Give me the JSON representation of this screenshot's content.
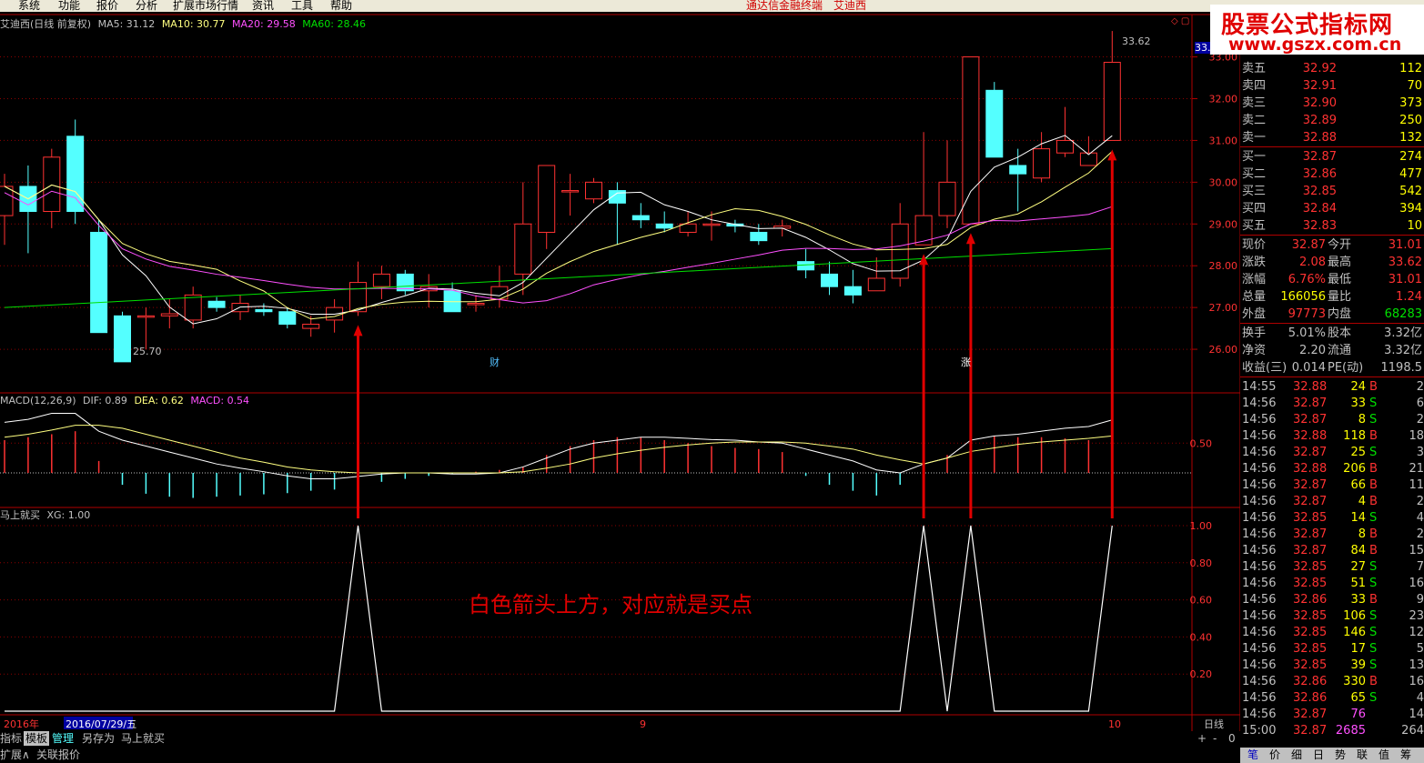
{
  "menu": {
    "items": [
      "系统",
      "功能",
      "报价",
      "分析",
      "扩展市场行情",
      "资讯",
      "工具",
      "帮助"
    ],
    "center_title": "通达信金融终端",
    "stock_name": "艾迪西"
  },
  "brand": {
    "line1": "股票公式指标网",
    "line2": "www.gszx.com.cn"
  },
  "main_header": {
    "title": "艾迪西(日线 前复权)",
    "ma5": "MA5: 31.12",
    "ma10": "MA10: 30.77",
    "ma20": "MA20: 29.58",
    "ma60": "MA60: 28.46"
  },
  "macd_header": {
    "title": "MACD(12,26,9)",
    "dif": "DIF: 0.89",
    "dea": "DEA: 0.62",
    "macd": "MACD: 0.54"
  },
  "xg_header": {
    "title": "马上就买",
    "xg": "XG: 1.00"
  },
  "annotation": "白色箭头上方，对应就是买点",
  "markers": {
    "cai": "财",
    "zhang": "涨"
  },
  "labels": {
    "high": "33.62",
    "low": "25.70",
    "current_price_tag": "33.0",
    "window_icons": "◇ ▢"
  },
  "price_axis": [
    "33.00",
    "32.00",
    "31.00",
    "30.00",
    "29.00",
    "28.00",
    "27.00",
    "26.00"
  ],
  "macd_axis": [
    "0.50"
  ],
  "xg_axis": [
    "1.00",
    "0.80",
    "0.60",
    "0.40",
    "0.20"
  ],
  "time_axis": {
    "year": "2016年",
    "cursor_date": "2016/07/29/五",
    "tick_9": "9",
    "tick_10": "10",
    "period": "日线"
  },
  "bottom_tabs": [
    "指标",
    "模板",
    "管理",
    "另存为",
    "马上就买"
  ],
  "bottom_tabs2": [
    "扩展∧",
    "关联报价"
  ],
  "bottom_right": [
    "+",
    "-",
    "0"
  ],
  "side_tabs": [
    "笔",
    "价",
    "细",
    "日",
    "势",
    "联",
    "值",
    "筹"
  ],
  "colors": {
    "up": "#ff3232",
    "down": "#54ffff",
    "ma5": "#ffffff",
    "ma10": "#ffff80",
    "ma20": "#ff50ff",
    "ma60": "#00e000",
    "grid": "#8b0000",
    "arrow": "#e00000"
  },
  "chart_data": {
    "type": "candlestick",
    "candles": [
      {
        "o": 29.2,
        "h": 30.2,
        "l": 28.5,
        "c": 29.9
      },
      {
        "o": 29.9,
        "h": 30.4,
        "l": 28.3,
        "c": 29.3
      },
      {
        "o": 29.3,
        "h": 30.8,
        "l": 28.9,
        "c": 30.6
      },
      {
        "o": 31.1,
        "h": 31.5,
        "l": 29.0,
        "c": 29.3
      },
      {
        "o": 28.8,
        "h": 29.1,
        "l": 26.4,
        "c": 26.4
      },
      {
        "o": 26.8,
        "h": 26.9,
        "l": 25.7,
        "c": 25.7
      },
      {
        "o": 26.8,
        "h": 27.0,
        "l": 26.0,
        "c": 26.8
      },
      {
        "o": 26.8,
        "h": 27.2,
        "l": 26.5,
        "c": 26.85
      },
      {
        "o": 26.7,
        "h": 27.5,
        "l": 26.5,
        "c": 27.3
      },
      {
        "o": 27.15,
        "h": 27.25,
        "l": 26.9,
        "c": 27.0
      },
      {
        "o": 26.9,
        "h": 27.3,
        "l": 26.7,
        "c": 27.1
      },
      {
        "o": 26.95,
        "h": 27.1,
        "l": 26.8,
        "c": 26.9
      },
      {
        "o": 26.9,
        "h": 27.0,
        "l": 26.5,
        "c": 26.6
      },
      {
        "o": 26.5,
        "h": 26.8,
        "l": 26.3,
        "c": 26.6
      },
      {
        "o": 26.7,
        "h": 27.2,
        "l": 26.4,
        "c": 27.0
      },
      {
        "o": 26.9,
        "h": 28.1,
        "l": 26.8,
        "c": 27.6
      },
      {
        "o": 27.5,
        "h": 28.0,
        "l": 27.2,
        "c": 27.8
      },
      {
        "o": 27.8,
        "h": 27.9,
        "l": 27.3,
        "c": 27.4
      },
      {
        "o": 27.4,
        "h": 27.8,
        "l": 27.0,
        "c": 27.5
      },
      {
        "o": 27.4,
        "h": 27.6,
        "l": 26.9,
        "c": 26.9
      },
      {
        "o": 27.1,
        "h": 27.3,
        "l": 26.9,
        "c": 27.1
      },
      {
        "o": 27.2,
        "h": 28.0,
        "l": 27.0,
        "c": 27.5
      },
      {
        "o": 27.8,
        "h": 30.0,
        "l": 27.3,
        "c": 29.0
      },
      {
        "o": 28.8,
        "h": 30.4,
        "l": 28.4,
        "c": 30.4
      },
      {
        "o": 29.8,
        "h": 30.2,
        "l": 29.2,
        "c": 29.8
      },
      {
        "o": 29.6,
        "h": 30.1,
        "l": 29.5,
        "c": 30.0
      },
      {
        "o": 29.8,
        "h": 30.0,
        "l": 28.5,
        "c": 29.5
      },
      {
        "o": 29.2,
        "h": 29.5,
        "l": 28.9,
        "c": 29.1
      },
      {
        "o": 29.0,
        "h": 29.3,
        "l": 28.8,
        "c": 28.9
      },
      {
        "o": 28.8,
        "h": 29.3,
        "l": 28.7,
        "c": 29.0
      },
      {
        "o": 29.0,
        "h": 29.3,
        "l": 28.6,
        "c": 29.0
      },
      {
        "o": 29.0,
        "h": 29.1,
        "l": 28.8,
        "c": 28.95
      },
      {
        "o": 28.8,
        "h": 29.0,
        "l": 28.5,
        "c": 28.6
      },
      {
        "o": 28.9,
        "h": 29.1,
        "l": 28.7,
        "c": 28.95
      },
      {
        "o": 28.1,
        "h": 28.4,
        "l": 27.7,
        "c": 27.9
      },
      {
        "o": 27.8,
        "h": 28.1,
        "l": 27.3,
        "c": 27.5
      },
      {
        "o": 27.5,
        "h": 27.9,
        "l": 27.1,
        "c": 27.3
      },
      {
        "o": 27.4,
        "h": 28.2,
        "l": 27.4,
        "c": 27.7
      },
      {
        "o": 27.7,
        "h": 29.5,
        "l": 27.5,
        "c": 29.0
      },
      {
        "o": 28.5,
        "h": 31.2,
        "l": 28.5,
        "c": 29.2
      },
      {
        "o": 29.2,
        "h": 31.0,
        "l": 28.9,
        "c": 30.0
      },
      {
        "o": 29.0,
        "h": 33.0,
        "l": 29.0,
        "c": 33.0
      },
      {
        "o": 32.2,
        "h": 32.4,
        "l": 30.6,
        "c": 30.6
      },
      {
        "o": 30.4,
        "h": 30.8,
        "l": 29.3,
        "c": 30.2
      },
      {
        "o": 30.1,
        "h": 31.2,
        "l": 30.0,
        "c": 30.8
      },
      {
        "o": 30.7,
        "h": 31.8,
        "l": 30.6,
        "c": 31.0
      },
      {
        "o": 30.4,
        "h": 31.1,
        "l": 30.4,
        "c": 30.7
      },
      {
        "o": 31.0,
        "h": 33.62,
        "l": 31.0,
        "c": 32.87
      }
    ],
    "macd_hist": [
      0.55,
      0.6,
      0.65,
      0.7,
      0.2,
      -0.2,
      -0.35,
      -0.4,
      -0.42,
      -0.4,
      -0.38,
      -0.36,
      -0.34,
      -0.3,
      -0.28,
      -0.22,
      -0.15,
      -0.1,
      -0.05,
      -0.02,
      0.02,
      0.05,
      0.1,
      0.3,
      0.45,
      0.55,
      0.6,
      0.6,
      0.55,
      0.5,
      0.45,
      0.42,
      0.4,
      0.35,
      -0.05,
      -0.2,
      -0.3,
      -0.38,
      -0.2,
      -0.05,
      0.3,
      0.55,
      0.62,
      0.6,
      0.6,
      0.58,
      0.55,
      0.54
    ],
    "dif": [
      0.85,
      0.9,
      1.0,
      1.0,
      0.7,
      0.55,
      0.45,
      0.35,
      0.25,
      0.15,
      0.08,
      0.02,
      -0.05,
      -0.1,
      -0.1,
      -0.06,
      -0.02,
      0.0,
      0.0,
      -0.02,
      -0.02,
      0.0,
      0.1,
      0.25,
      0.4,
      0.5,
      0.55,
      0.6,
      0.6,
      0.58,
      0.56,
      0.55,
      0.52,
      0.5,
      0.4,
      0.3,
      0.2,
      0.05,
      0.0,
      0.15,
      0.25,
      0.55,
      0.62,
      0.65,
      0.7,
      0.75,
      0.78,
      0.89
    ],
    "dea": [
      0.6,
      0.65,
      0.72,
      0.8,
      0.8,
      0.75,
      0.65,
      0.55,
      0.45,
      0.35,
      0.25,
      0.18,
      0.1,
      0.05,
      0.02,
      0.0,
      0.0,
      0.0,
      0.0,
      0.0,
      0.0,
      0.0,
      0.02,
      0.08,
      0.15,
      0.25,
      0.32,
      0.38,
      0.43,
      0.47,
      0.5,
      0.52,
      0.52,
      0.52,
      0.5,
      0.45,
      0.4,
      0.3,
      0.22,
      0.15,
      0.25,
      0.36,
      0.42,
      0.48,
      0.52,
      0.55,
      0.58,
      0.62
    ],
    "xg": [
      0,
      0,
      0,
      0,
      0,
      0,
      0,
      0,
      0,
      0,
      0,
      0,
      0,
      0,
      0,
      1,
      0,
      0,
      0,
      0,
      0,
      0,
      0,
      0,
      0,
      0,
      0,
      0,
      0,
      0,
      0,
      0,
      0,
      0,
      0,
      0,
      0,
      0,
      0,
      1,
      0,
      1,
      0,
      0,
      0,
      0,
      0,
      1
    ],
    "price_ylim": [
      25.0,
      33.6
    ],
    "macd_ylim": [
      -0.55,
      1.1
    ],
    "xg_ylim": [
      0,
      1
    ]
  },
  "quote": {
    "asks": [
      {
        "label": "卖五",
        "price": "32.92",
        "vol": "112"
      },
      {
        "label": "卖四",
        "price": "32.91",
        "vol": "70"
      },
      {
        "label": "卖三",
        "price": "32.90",
        "vol": "373"
      },
      {
        "label": "卖二",
        "price": "32.89",
        "vol": "250"
      },
      {
        "label": "卖一",
        "price": "32.88",
        "vol": "132"
      }
    ],
    "bids": [
      {
        "label": "买一",
        "price": "32.87",
        "vol": "274"
      },
      {
        "label": "买二",
        "price": "32.86",
        "vol": "477"
      },
      {
        "label": "买三",
        "price": "32.85",
        "vol": "542"
      },
      {
        "label": "买四",
        "price": "32.84",
        "vol": "394"
      },
      {
        "label": "买五",
        "price": "32.83",
        "vol": "10"
      }
    ],
    "stats": [
      {
        "l1": "现价",
        "v1": "32.87",
        "l2": "今开",
        "v2": "31.01"
      },
      {
        "l1": "涨跌",
        "v1": "2.08",
        "l2": "最高",
        "v2": "33.62"
      },
      {
        "l1": "涨幅",
        "v1": "6.76%",
        "l2": "最低",
        "v2": "31.01"
      },
      {
        "l1": "总量",
        "v1": "166056",
        "l2": "量比",
        "v2": "1.24"
      },
      {
        "l1": "外盘",
        "v1": "97773",
        "l2": "内盘",
        "v2": "68283"
      }
    ],
    "fund": [
      {
        "l1": "换手",
        "v1": "5.01%",
        "l2": "股本",
        "v2": "3.32亿"
      },
      {
        "l1": "净资",
        "v1": "2.20",
        "l2": "流通",
        "v2": "3.32亿"
      },
      {
        "l1": "收益(三)",
        "v1": "0.014",
        "l2": "PE(动)",
        "v2": "1198.5"
      }
    ],
    "ticks": [
      {
        "t": "14:55",
        "p": "32.88",
        "v": "24",
        "d": "B",
        "n": "2"
      },
      {
        "t": "14:56",
        "p": "32.87",
        "v": "33",
        "d": "S",
        "n": "6"
      },
      {
        "t": "14:56",
        "p": "32.87",
        "v": "8",
        "d": "S",
        "n": "2"
      },
      {
        "t": "14:56",
        "p": "32.88",
        "v": "118",
        "d": "B",
        "n": "18"
      },
      {
        "t": "14:56",
        "p": "32.87",
        "v": "25",
        "d": "S",
        "n": "3"
      },
      {
        "t": "14:56",
        "p": "32.88",
        "v": "206",
        "d": "B",
        "n": "21"
      },
      {
        "t": "14:56",
        "p": "32.87",
        "v": "66",
        "d": "B",
        "n": "11"
      },
      {
        "t": "14:56",
        "p": "32.87",
        "v": "4",
        "d": "B",
        "n": "2"
      },
      {
        "t": "14:56",
        "p": "32.85",
        "v": "14",
        "d": "S",
        "n": "4"
      },
      {
        "t": "14:56",
        "p": "32.87",
        "v": "8",
        "d": "B",
        "n": "2"
      },
      {
        "t": "14:56",
        "p": "32.87",
        "v": "84",
        "d": "B",
        "n": "15"
      },
      {
        "t": "14:56",
        "p": "32.85",
        "v": "27",
        "d": "S",
        "n": "7"
      },
      {
        "t": "14:56",
        "p": "32.85",
        "v": "51",
        "d": "S",
        "n": "16"
      },
      {
        "t": "14:56",
        "p": "32.86",
        "v": "33",
        "d": "B",
        "n": "9"
      },
      {
        "t": "14:56",
        "p": "32.85",
        "v": "106",
        "d": "S",
        "n": "23"
      },
      {
        "t": "14:56",
        "p": "32.85",
        "v": "146",
        "d": "S",
        "n": "12"
      },
      {
        "t": "14:56",
        "p": "32.85",
        "v": "17",
        "d": "S",
        "n": "5"
      },
      {
        "t": "14:56",
        "p": "32.85",
        "v": "39",
        "d": "S",
        "n": "13"
      },
      {
        "t": "14:56",
        "p": "32.86",
        "v": "330",
        "d": "B",
        "n": "16"
      },
      {
        "t": "14:56",
        "p": "32.86",
        "v": "65",
        "d": "S",
        "n": "4"
      },
      {
        "t": "14:56",
        "p": "32.87",
        "v": "76",
        "d": "",
        "n": "14"
      },
      {
        "t": "15:00",
        "p": "32.87",
        "v": "2685",
        "d": "",
        "n": "264"
      }
    ]
  }
}
